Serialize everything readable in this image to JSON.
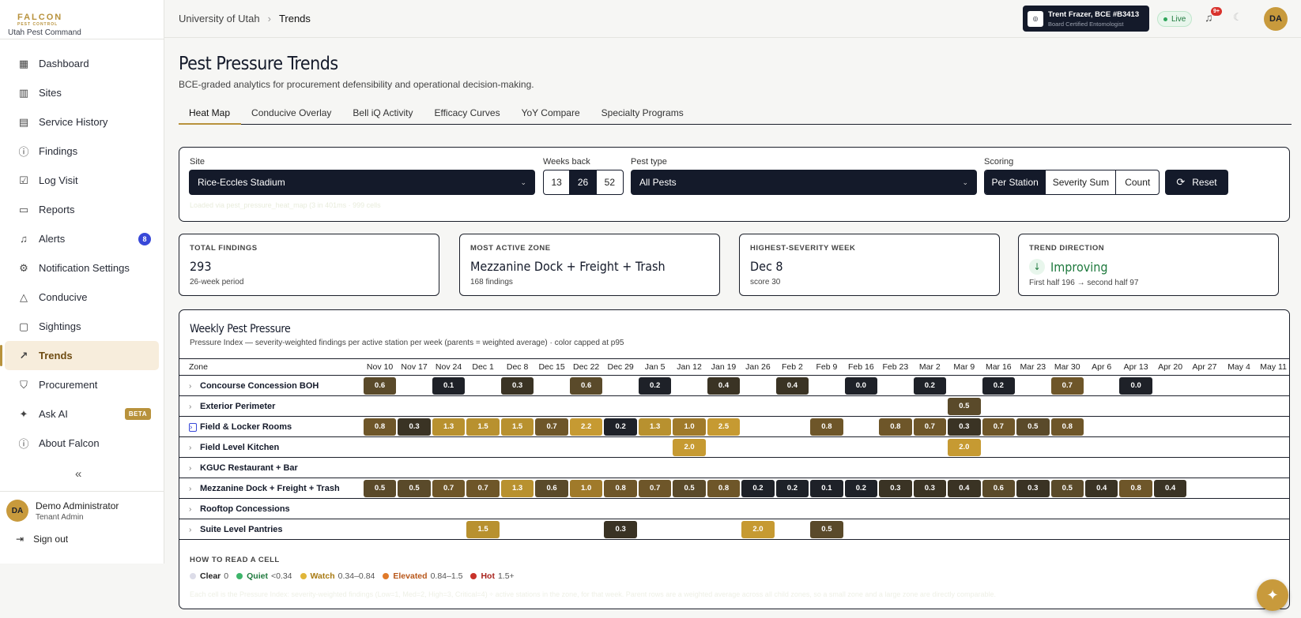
{
  "brand": {
    "logo": "FALCON",
    "logo_sub": "PEST CONTROL",
    "tenant": "Utah Pest Command"
  },
  "nav": [
    {
      "label": "Dashboard",
      "icon": "dashboard-icon",
      "glyph": "▦"
    },
    {
      "label": "Sites",
      "icon": "building-icon",
      "glyph": "▥"
    },
    {
      "label": "Service History",
      "icon": "clipboard-icon",
      "glyph": "▤"
    },
    {
      "label": "Findings",
      "icon": "alert-circle-icon",
      "glyph": "ⓘ"
    },
    {
      "label": "Log Visit",
      "icon": "clipboard-check-icon",
      "glyph": "☑"
    },
    {
      "label": "Reports",
      "icon": "file-icon",
      "glyph": "▭"
    },
    {
      "label": "Alerts",
      "icon": "bell-icon",
      "glyph": "♫",
      "count": "8"
    },
    {
      "label": "Notification Settings",
      "icon": "gear-icon",
      "glyph": "⚙"
    },
    {
      "label": "Conducive",
      "icon": "warning-icon",
      "glyph": "△"
    },
    {
      "label": "Sightings",
      "icon": "message-icon",
      "glyph": "▢"
    },
    {
      "label": "Trends",
      "icon": "trending-up-icon",
      "glyph": "↗",
      "active": true
    },
    {
      "label": "Procurement",
      "icon": "shield-icon",
      "glyph": "⛉"
    },
    {
      "label": "Ask AI",
      "icon": "sparkle-icon",
      "glyph": "✦",
      "beta": "BETA"
    },
    {
      "label": "About Falcon",
      "icon": "info-icon",
      "glyph": "ⓘ"
    }
  ],
  "user": {
    "initials": "DA",
    "name": "Demo Administrator",
    "role": "Tenant Admin",
    "signout": "Sign out"
  },
  "breadcrumb": {
    "parent": "University of Utah",
    "current": "Trends"
  },
  "header": {
    "bce_name": "Trent Frazer, BCE #B3413",
    "bce_title": "Board Certified Entomologist",
    "live": "Live",
    "notif_count": "9+",
    "initials": "DA"
  },
  "page": {
    "title": "Pest Pressure Trends",
    "subtitle": "BCE-graded analytics for procurement defensibility and operational decision-making."
  },
  "tabs": [
    "Heat Map",
    "Conducive Overlay",
    "Bell iQ Activity",
    "Efficacy Curves",
    "YoY Compare",
    "Specialty Programs"
  ],
  "filters": {
    "site_label": "Site",
    "site_value": "Rice-Eccles Stadium",
    "weeks_label": "Weeks back",
    "weeks": [
      "13",
      "26",
      "52"
    ],
    "weeks_selected": "26",
    "pest_label": "Pest type",
    "pest_value": "All Pests",
    "scoring_label": "Scoring",
    "scoring": [
      "Per Station",
      "Severity Sum",
      "Count"
    ],
    "scoring_selected": "Per Station",
    "reset": "Reset",
    "loaded": "Loaded via pest_pressure_heat_map (3 in 401ms · 999 cells"
  },
  "kpis": [
    {
      "label": "TOTAL FINDINGS",
      "value": "293",
      "detail": "26-week period"
    },
    {
      "label": "MOST ACTIVE ZONE",
      "value": "Mezzanine Dock + Freight + Trash",
      "detail": "168 findings"
    },
    {
      "label": "HIGHEST-SEVERITY WEEK",
      "value": "Dec 8",
      "detail": "score 30"
    },
    {
      "label": "TREND DIRECTION",
      "value": "Improving",
      "detail": "First half 196 → second half 97"
    }
  ],
  "heatmap": {
    "title": "Weekly Pest Pressure",
    "subtitle": "Pressure Index — severity-weighted findings per active station per week (parents = weighted average) · color capped at p95",
    "zone_header": "Zone",
    "weeks": [
      "Nov 10",
      "Nov 17",
      "Nov 24",
      "Dec 1",
      "Dec 8",
      "Dec 15",
      "Dec 22",
      "Dec 29",
      "Jan 5",
      "Jan 12",
      "Jan 19",
      "Jan 26",
      "Feb 2",
      "Feb 9",
      "Feb 16",
      "Feb 23",
      "Mar 2",
      "Mar 9",
      "Mar 16",
      "Mar 23",
      "Mar 30",
      "Apr 6",
      "Apr 13",
      "Apr 20",
      "Apr 27",
      "May 4",
      "May 11"
    ],
    "rows": [
      {
        "zone": "Concourse Concession BOH",
        "cells": [
          0.6,
          null,
          0.1,
          null,
          0.3,
          null,
          0.6,
          null,
          0.2,
          null,
          0.4,
          null,
          0.4,
          null,
          0.0,
          null,
          0.2,
          null,
          0.2,
          null,
          0.7,
          null,
          0.0,
          null,
          null,
          null,
          null
        ]
      },
      {
        "zone": "Exterior Perimeter",
        "cells": [
          null,
          null,
          null,
          null,
          null,
          null,
          null,
          null,
          null,
          null,
          null,
          null,
          null,
          null,
          null,
          null,
          null,
          0.5,
          null,
          null,
          null,
          null,
          null,
          null,
          null,
          null,
          null
        ]
      },
      {
        "zone": "Field & Locker Rooms",
        "focus": true,
        "cells": [
          0.8,
          0.3,
          1.3,
          1.5,
          1.5,
          0.7,
          2.2,
          0.2,
          1.3,
          1.0,
          2.5,
          null,
          null,
          0.8,
          null,
          0.8,
          0.7,
          0.3,
          0.7,
          0.5,
          0.8,
          null,
          null,
          null,
          null,
          null,
          null
        ]
      },
      {
        "zone": "Field Level Kitchen",
        "cells": [
          null,
          null,
          null,
          null,
          null,
          null,
          null,
          null,
          null,
          2.0,
          null,
          null,
          null,
          null,
          null,
          null,
          null,
          2.0,
          null,
          null,
          null,
          null,
          null,
          null,
          null,
          null,
          null
        ]
      },
      {
        "zone": "KGUC Restaurant + Bar",
        "cells": [
          null,
          null,
          null,
          null,
          null,
          null,
          null,
          null,
          null,
          null,
          null,
          null,
          null,
          null,
          null,
          null,
          null,
          null,
          null,
          null,
          null,
          null,
          null,
          null,
          null,
          null,
          null
        ]
      },
      {
        "zone": "Mezzanine Dock + Freight + Trash",
        "cells": [
          0.5,
          0.5,
          0.7,
          0.7,
          1.3,
          0.6,
          1.0,
          0.8,
          0.7,
          0.5,
          0.8,
          0.2,
          0.2,
          0.1,
          0.2,
          0.3,
          0.3,
          0.4,
          0.6,
          0.3,
          0.5,
          0.4,
          0.8,
          0.4,
          null,
          null,
          null
        ]
      },
      {
        "zone": "Rooftop Concessions",
        "cells": [
          null,
          null,
          null,
          null,
          null,
          null,
          null,
          null,
          null,
          null,
          null,
          null,
          null,
          null,
          null,
          null,
          null,
          null,
          null,
          null,
          null,
          null,
          null,
          null,
          null,
          null,
          null
        ]
      },
      {
        "zone": "Suite Level Pantries",
        "cells": [
          null,
          null,
          null,
          1.5,
          null,
          null,
          null,
          0.3,
          null,
          null,
          null,
          2.0,
          null,
          0.5,
          null,
          null,
          null,
          null,
          null,
          null,
          null,
          null,
          null,
          null,
          null,
          null,
          null
        ]
      }
    ]
  },
  "legend": {
    "title": "HOW TO READ A CELL",
    "items": [
      {
        "name": "Clear",
        "range": "0",
        "color": "#dcdce8"
      },
      {
        "name": "Quiet",
        "range": "<0.34",
        "color": "#3db56a"
      },
      {
        "name": "Watch",
        "range": "0.34–0.84",
        "color": "#e0b63a"
      },
      {
        "name": "Elevated",
        "range": "0.84–1.5",
        "color": "#e07a2a"
      },
      {
        "name": "Hot",
        "range": "1.5+",
        "color": "#c8322a"
      }
    ],
    "name_colors": [
      "#222",
      "#1f7a3e",
      "#a87a12",
      "#b8571a",
      "#a8221c"
    ],
    "note": "Each cell is the Pressure Index: severity-weighted findings (Low=1, Med=2, High=3, Critical=4) ÷ active stations in the zone, for that week. Parent rows are a weighted average across all child zones, so a small zone and a large zone are directly comparable."
  },
  "colors": {
    "accent": "#b8923c",
    "dark": "#141a2a"
  }
}
